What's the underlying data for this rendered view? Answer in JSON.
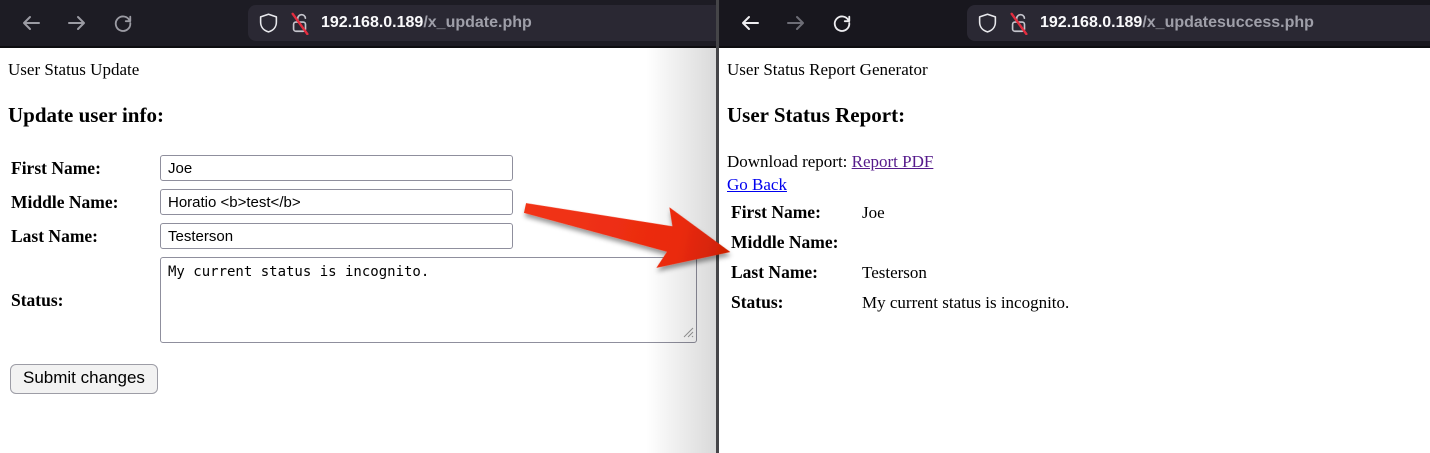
{
  "left_window": {
    "toolbar": {
      "url_domain": "192.168.0.189",
      "url_path": "/x_update.php"
    },
    "page": {
      "title": "User Status Update",
      "heading": "Update user info:",
      "fields": [
        {
          "label": "First Name:",
          "value": "Joe",
          "type": "text"
        },
        {
          "label": "Middle Name:",
          "value": "Horatio <b>test</b>",
          "type": "text"
        },
        {
          "label": "Last Name:",
          "value": "Testerson",
          "type": "text"
        },
        {
          "label": "Status:",
          "value": "My current status is incognito.",
          "type": "textarea"
        }
      ],
      "submit_label": "Submit changes"
    }
  },
  "right_window": {
    "toolbar": {
      "url_domain": "192.168.0.189",
      "url_path": "/x_updatesuccess.php"
    },
    "page": {
      "title": "User Status Report Generator",
      "heading": "User Status Report:",
      "download_label": "Download report: ",
      "download_link": "Report PDF",
      "back_link": "Go Back",
      "report_rows": [
        {
          "label": "First Name:",
          "value": "Joe"
        },
        {
          "label": "Middle Name:",
          "value": ""
        },
        {
          "label": "Last Name:",
          "value": "Testerson"
        },
        {
          "label": "Status:",
          "value": "My current status is incognito."
        }
      ]
    }
  },
  "icons": {
    "back": "arrow-left",
    "forward": "arrow-right",
    "reload": "circular-arrow",
    "shield": "shield-outline",
    "insecure_lock": "lock-with-red-slash"
  },
  "colors": {
    "toolbar_bg": "#1c1b22",
    "urlbar_bg": "#2a2833",
    "url_domain": "#f9f9fb",
    "url_path": "#9f9fa9",
    "link_blue": "#0000ee",
    "link_visited": "#551a8b",
    "arrow_red": "#ea2a0e"
  }
}
